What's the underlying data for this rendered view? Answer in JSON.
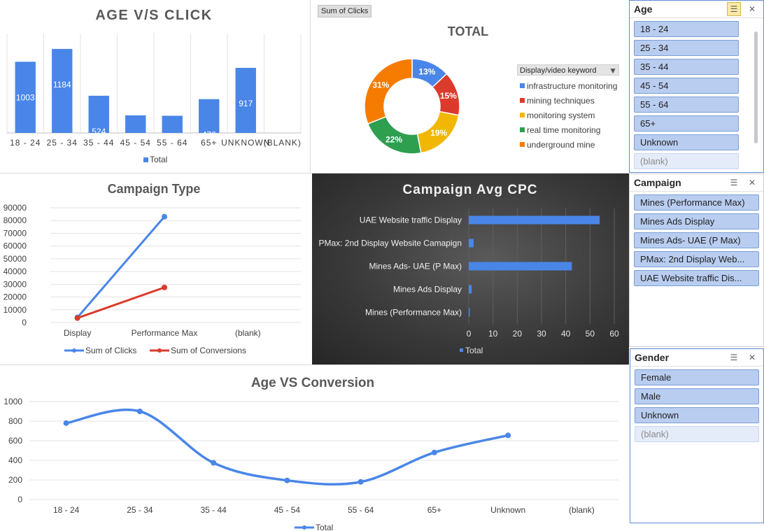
{
  "colors": {
    "blue": "#4a86e8",
    "red": "#db3b2b",
    "yellow": "#f2b705",
    "green": "#2e9e4f",
    "orange": "#f57c00"
  },
  "age_click": {
    "title": "AGE V/S CLICK",
    "legend": "Total",
    "chart_data": {
      "type": "bar",
      "categories": [
        "18 - 24",
        "25 - 34",
        "35 - 44",
        "45 - 54",
        "55 - 64",
        "65+",
        "UNKNOWN",
        "(BLANK)"
      ],
      "values": [
        1003,
        1184,
        524,
        248,
        242,
        476,
        917,
        null
      ],
      "ylim": [
        0,
        1400
      ]
    }
  },
  "total_donut": {
    "field_chip": "Sum of Clicks",
    "title": "TOTAL",
    "legend_header": "Display/video keyword",
    "chart_data": {
      "type": "pie",
      "categories": [
        "infrastructure monitoring",
        "mining techniques",
        "monitoring system",
        "real time monitoring",
        "underground mine"
      ],
      "values": [
        13,
        15,
        19,
        22,
        31
      ],
      "labels": [
        "13%",
        "15%",
        "19%",
        "22%",
        "31%"
      ]
    }
  },
  "campaign_type": {
    "title": "Campaign Type",
    "chart_data": {
      "type": "line",
      "categories": [
        "Display",
        "Performance Max",
        "(blank)"
      ],
      "yticks": [
        "90000",
        "80000",
        "70000",
        "60000",
        "50000",
        "40000",
        "30000",
        "20000",
        "10000",
        "0"
      ],
      "ylim": [
        0,
        90000
      ],
      "series": [
        {
          "name": "Sum of Clicks",
          "values": [
            4000,
            83000,
            null
          ]
        },
        {
          "name": "Sum of Conversions",
          "values": [
            3500,
            27500,
            null
          ]
        }
      ]
    }
  },
  "avg_cpc": {
    "title": "Campaign Avg CPC",
    "legend": "Total",
    "chart_data": {
      "type": "bar",
      "categories": [
        "UAE Website traffic Display",
        "PMax: 2nd Display Website Camapign",
        "Mines Ads- UAE (P Max)",
        "Mines Ads Display",
        "Mines (Performance Max)"
      ],
      "values": [
        54,
        2,
        42.5,
        1.2,
        0.4
      ],
      "xticks": [
        "0",
        "10",
        "20",
        "30",
        "40",
        "50",
        "60"
      ],
      "xlim": [
        0,
        60
      ]
    }
  },
  "age_conversion": {
    "title": "Age VS Conversion",
    "legend": "Total",
    "chart_data": {
      "type": "line",
      "categories": [
        "18 - 24",
        "25 - 34",
        "35 - 44",
        "45 - 54",
        "55 - 64",
        "65+",
        "Unknown",
        "(blank)"
      ],
      "values": [
        780,
        900,
        375,
        195,
        180,
        480,
        655,
        null
      ],
      "yticks": [
        "1000",
        "800",
        "600",
        "400",
        "200",
        "0"
      ],
      "ylim": [
        0,
        1000
      ]
    }
  },
  "slicers": {
    "age": {
      "title": "Age",
      "items": [
        "18 - 24",
        "25 - 34",
        "35 - 44",
        "45 - 54",
        "55 - 64",
        "65+",
        "Unknown",
        "(blank)"
      ]
    },
    "campaign": {
      "title": "Campaign",
      "items": [
        "Mines (Performance Max)",
        "Mines Ads Display",
        "Mines Ads- UAE (P Max)",
        "PMax: 2nd Display Web...",
        "UAE Website traffic Dis..."
      ]
    },
    "gender": {
      "title": "Gender",
      "items": [
        "Female",
        "Male",
        "Unknown",
        "(blank)"
      ]
    }
  }
}
